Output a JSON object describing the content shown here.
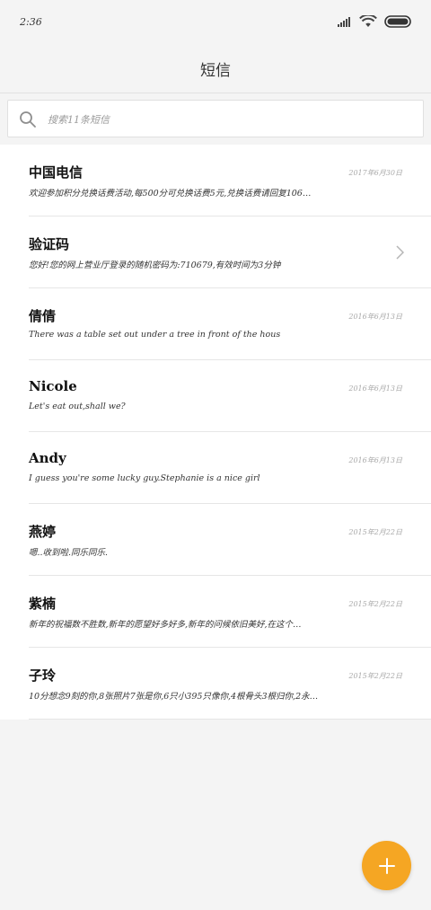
{
  "status_bar": {
    "time": "2:36",
    "icons": [
      "signal-icon",
      "wifi-icon",
      "battery-icon"
    ]
  },
  "header": {
    "title": "短信"
  },
  "search": {
    "placeholder": "搜索11条短信"
  },
  "messages": [
    {
      "name": "中国电信",
      "date": "2017年6月30日",
      "preview": "欢迎参加积分兑换话费活动,每500分可兑换话费5元,兑换话费请回复106…"
    },
    {
      "name": "验证码",
      "date": "",
      "preview": "您好!您的网上营业厅登录的随机密码为:710679,有效时间为3分钟"
    },
    {
      "name": "倩倩",
      "date": "2016年6月13日",
      "preview": "There was a table set out under a tree in front of the hous"
    },
    {
      "name": "Nicole",
      "date": "2016年6月13日",
      "preview": "Let's eat out,shall we?"
    },
    {
      "name": "Andy",
      "date": "2016年6月13日",
      "preview": "I guess you're some lucky guy.Stephanie is a nice girl"
    },
    {
      "name": "燕婷",
      "date": "2015年2月22日",
      "preview": "嗯..收到啦.同乐同乐."
    },
    {
      "name": "紫楠",
      "date": "2015年2月22日",
      "preview": "新年的祝福数不胜数,新年的愿望好多好多,新年的问候依旧美好,在这个…"
    },
    {
      "name": "子玲",
      "date": "2015年2月22日",
      "preview": "10分想念9刻的你,8张照片7张是你,6只小395只像你,4根骨头3根归你,2永…"
    }
  ],
  "colors": {
    "background": "#f4f4f4",
    "list_background": "#ffffff",
    "fab": "#f5a623",
    "divider": "#e6e6e6"
  },
  "fab": {
    "icon": "plus-icon"
  }
}
